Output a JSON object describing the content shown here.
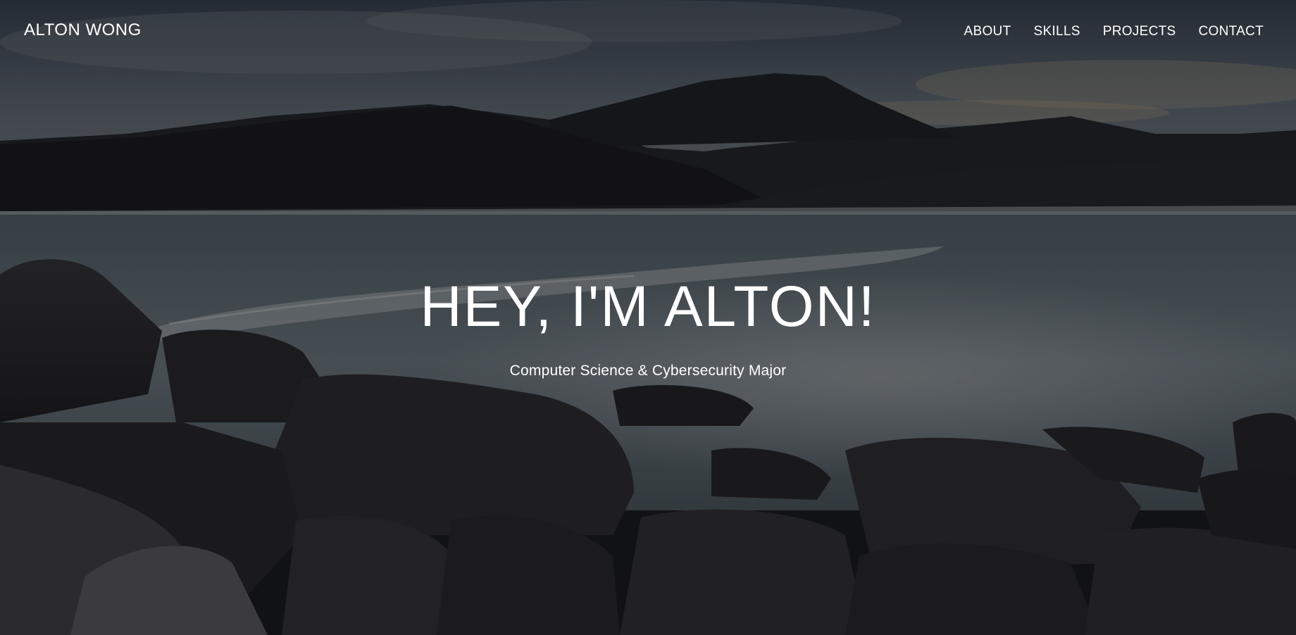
{
  "brand": "ALTON WONG",
  "nav": {
    "items": [
      {
        "label": "ABOUT"
      },
      {
        "label": "SKILLS"
      },
      {
        "label": "PROJECTS"
      },
      {
        "label": "CONTACT"
      }
    ]
  },
  "hero": {
    "title": "HEY, I'M ALTON!",
    "subtitle": "Computer Science & Cybersecurity Major",
    "background": "coastal beach landscape with mountains, ocean waves and foreground boulders, darkened overlay"
  },
  "colors": {
    "text": "#ffffff",
    "sky": "#5e6a78",
    "mountain": "#1f2025",
    "water": "#6b7a84",
    "rock": "#2e2d31",
    "overlay": "#000000"
  }
}
